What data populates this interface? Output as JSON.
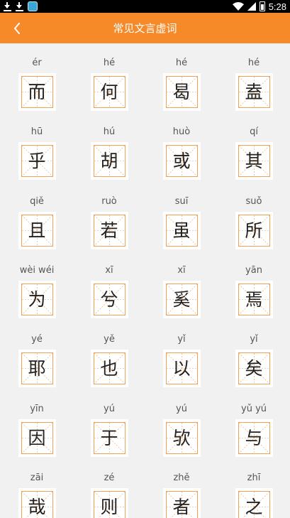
{
  "status_bar": {
    "time": "5:28",
    "icons": [
      "download-icon",
      "download-icon",
      "app-notification-icon",
      "wifi-icon",
      "signal-icon",
      "battery-icon"
    ]
  },
  "header": {
    "title": "常见文言虚词",
    "back_icon": "chevron-left-icon",
    "background_color": "#f68a29"
  },
  "grid_colors": {
    "guide_line": "#f2a056",
    "box_background": "#ffffff"
  },
  "words": [
    {
      "pinyin": "ér",
      "char": "而"
    },
    {
      "pinyin": "hé",
      "char": "何"
    },
    {
      "pinyin": "hé",
      "char": "曷"
    },
    {
      "pinyin": "hé",
      "char": "盍"
    },
    {
      "pinyin": "hū",
      "char": "乎"
    },
    {
      "pinyin": "hú",
      "char": "胡"
    },
    {
      "pinyin": "huò",
      "char": "或"
    },
    {
      "pinyin": "qí",
      "char": "其"
    },
    {
      "pinyin": "qiě",
      "char": "且"
    },
    {
      "pinyin": "ruò",
      "char": "若"
    },
    {
      "pinyin": "suī",
      "char": "虽"
    },
    {
      "pinyin": "suǒ",
      "char": "所"
    },
    {
      "pinyin": "wèi wéi",
      "char": "为"
    },
    {
      "pinyin": "xī",
      "char": "兮"
    },
    {
      "pinyin": "xī",
      "char": "奚"
    },
    {
      "pinyin": "yān",
      "char": "焉"
    },
    {
      "pinyin": "yé",
      "char": "耶"
    },
    {
      "pinyin": "yě",
      "char": "也"
    },
    {
      "pinyin": "yǐ",
      "char": "以"
    },
    {
      "pinyin": "yǐ",
      "char": "矣"
    },
    {
      "pinyin": "yīn",
      "char": "因"
    },
    {
      "pinyin": "yú",
      "char": "于"
    },
    {
      "pinyin": "yú",
      "char": "欤"
    },
    {
      "pinyin": "yǔ yú",
      "char": "与"
    },
    {
      "pinyin": "zāi",
      "char": "哉"
    },
    {
      "pinyin": "zé",
      "char": "则"
    },
    {
      "pinyin": "zhě",
      "char": "者"
    },
    {
      "pinyin": "zhī",
      "char": "之"
    }
  ]
}
